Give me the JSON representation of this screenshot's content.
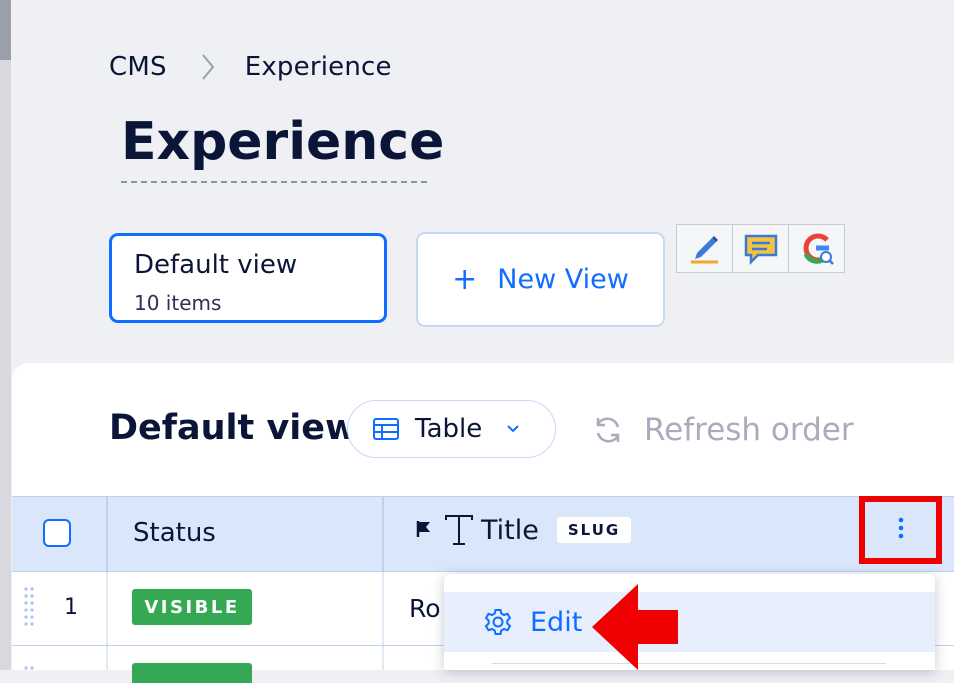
{
  "breadcrumb": {
    "root": "CMS",
    "current": "Experience"
  },
  "page_title": "Experience",
  "views": {
    "default": {
      "name": "Default view",
      "count": "10 items"
    },
    "new_view_label": "New View",
    "new_view_prefix": "+"
  },
  "extension_icons": [
    "pencil-icon",
    "comment-icon",
    "google-search-icon"
  ],
  "toolbar": {
    "title": "Default view",
    "layout_label": "Table",
    "refresh_label": "Refresh order"
  },
  "table": {
    "columns": [
      {
        "label": "Status"
      },
      {
        "label": "Title",
        "tag": "SLUG"
      }
    ],
    "rows": [
      {
        "num": "1",
        "status": "VISIBLE",
        "title": "Ro"
      }
    ]
  },
  "context_menu": {
    "items": [
      {
        "label": "Edit",
        "icon": "gear-icon"
      }
    ]
  },
  "colors": {
    "accent": "#116dff",
    "visible_badge": "#34a853",
    "highlight": "#f00000",
    "header_bg": "#dae6fa"
  }
}
